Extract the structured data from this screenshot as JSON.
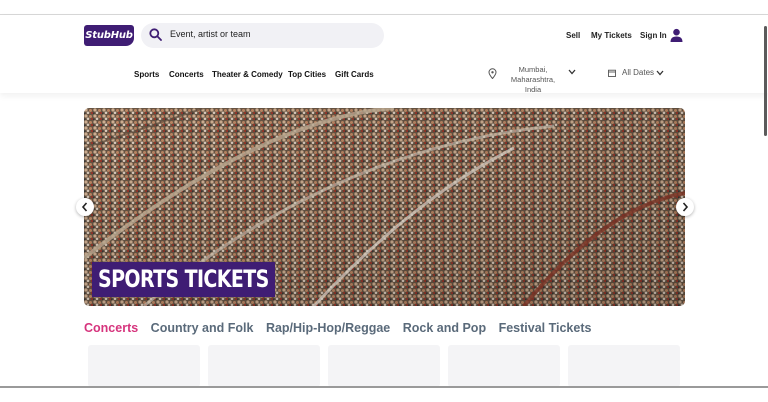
{
  "header": {
    "logo": "StubHub",
    "search_placeholder": "Event, artist or team",
    "links": [
      "Sell",
      "My Tickets",
      "Sign In"
    ],
    "nav": [
      "Sports",
      "Concerts",
      "Theater & Comedy",
      "Top Cities",
      "Gift Cards"
    ],
    "location": [
      "Mumbai,",
      "Maharashtra, India"
    ],
    "dates": "All Dates"
  },
  "hero": {
    "label": "SPORTS TICKETS"
  },
  "categories": [
    "Concerts",
    "Country and Folk",
    "Rap/Hip-Hop/Reggae",
    "Rock and Pop",
    "Festival Tickets"
  ],
  "colors": {
    "brand": "#3f1d74",
    "active": "#d6347d"
  }
}
